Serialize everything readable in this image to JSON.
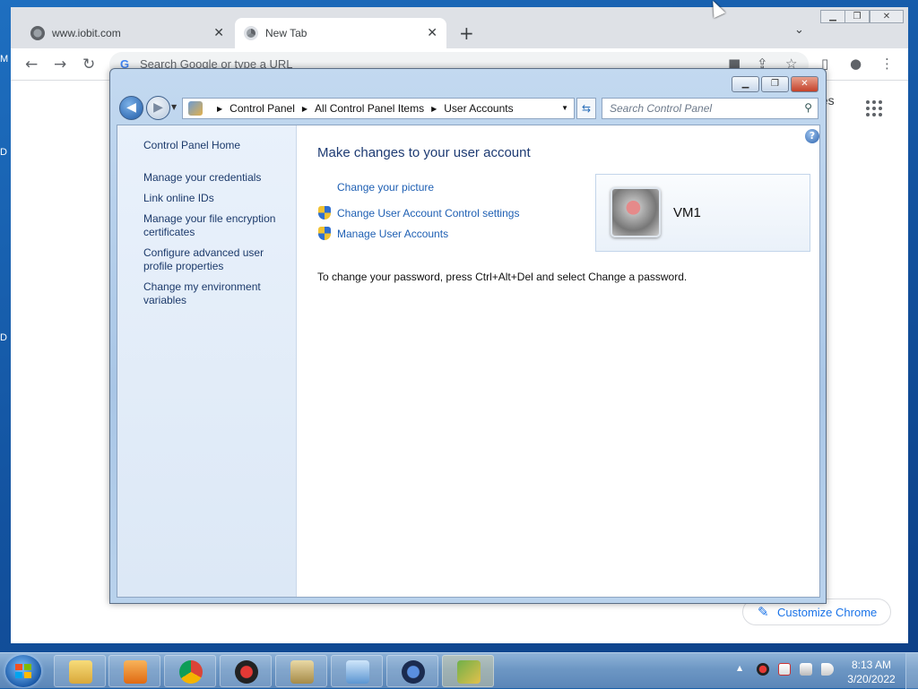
{
  "desktop": {
    "edge_letters": [
      "M",
      "D",
      "D"
    ]
  },
  "chrome": {
    "tabs": [
      {
        "label": "www.iobit.com",
        "icon": "globe-icon"
      },
      {
        "label": "New Tab",
        "icon": "chrome-icon",
        "active": true
      }
    ],
    "omnibox_placeholder": "Search Google or type a URL",
    "images_link": "ges",
    "customize_label": "Customize Chrome"
  },
  "control_panel": {
    "breadcrumb": [
      "Control Panel",
      "All Control Panel Items",
      "User Accounts"
    ],
    "search_placeholder": "Search Control Panel",
    "left_links": [
      "Control Panel Home",
      "Manage your credentials",
      "Link online IDs",
      "Manage your file encryption certificates",
      "Configure advanced user profile properties",
      "Change my environment variables"
    ],
    "heading": "Make changes to your user account",
    "actions": [
      {
        "label": "Change your picture",
        "shield": false
      },
      {
        "label": "Change User Account Control settings",
        "shield": true
      },
      {
        "label": "Manage User Accounts",
        "shield": true
      }
    ],
    "account_name": "VM1",
    "password_note": "To change your password, press Ctrl+Alt+Del and select Change a password."
  },
  "taskbar": {
    "pinned": [
      "explorer-icon",
      "media-player-icon",
      "chrome-icon",
      "iobit-icon",
      "user-accounts-icon",
      "network-icon",
      "app-icon",
      "control-panel-icon"
    ],
    "time": "8:13 AM",
    "date": "3/20/2022"
  },
  "colors": {
    "link": "#1e5fb3",
    "heading": "#1e3b73",
    "taskbar": "#6d97c4"
  }
}
